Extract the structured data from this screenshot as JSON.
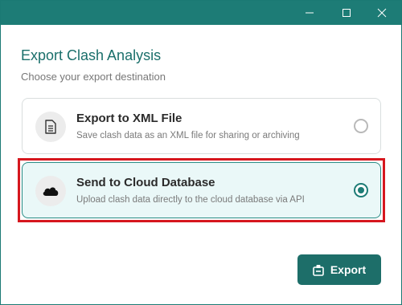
{
  "window": {
    "title": "",
    "accent_color": "#1d7c76"
  },
  "dialog": {
    "heading": "Export Clash Analysis",
    "subheading": "Choose your export destination"
  },
  "options": [
    {
      "title": "Export to XML File",
      "description": "Save clash data as an XML file for sharing or archiving",
      "icon": "document-icon",
      "selected": false
    },
    {
      "title": "Send to Cloud Database",
      "description": "Upload clash data directly to the cloud database via API",
      "icon": "cloud-icon",
      "selected": true
    }
  ],
  "export_button": {
    "label": "Export",
    "icon": "export-icon"
  },
  "highlight_color": "#d6171e"
}
